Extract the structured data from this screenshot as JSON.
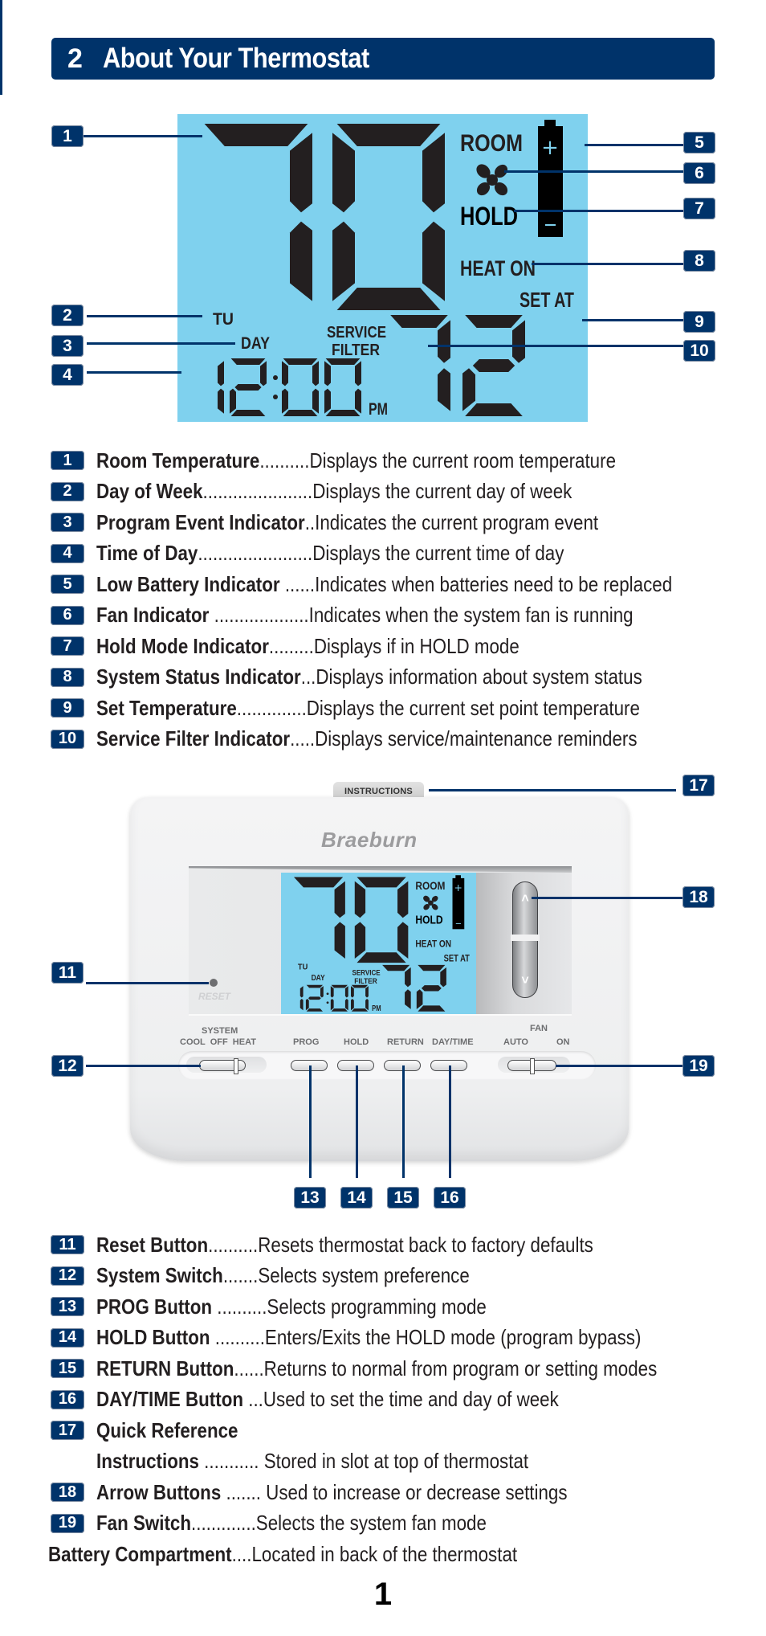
{
  "header": {
    "section_number": "2",
    "title": "About Your Thermostat"
  },
  "display": {
    "room_temp": "70",
    "room_label": "ROOM",
    "hold_label": "HOLD",
    "status_label": "HEAT ON",
    "set_at_label": "SET AT",
    "set_temp": "72",
    "day": "TU",
    "event_label": "DAY",
    "time": "12:00",
    "ampm": "PM",
    "service_label_1": "SERVICE",
    "service_label_2": "FILTER",
    "battery_plus": "+",
    "battery_minus": "–",
    "fan_icon": "fan-icon",
    "battery_icon": "battery-icon"
  },
  "display_callouts": [
    "1",
    "2",
    "3",
    "4",
    "5",
    "6",
    "7",
    "8",
    "9",
    "10"
  ],
  "display_legend": [
    {
      "num": "1",
      "label": "Room Temperature",
      "dots": "..........",
      "desc": "Displays the current room temperature"
    },
    {
      "num": "2",
      "label": "Day of Week",
      "dots": "......................",
      "desc": "Displays the current day of week"
    },
    {
      "num": "3",
      "label": "Program Event Indicator",
      "dots": "..",
      "desc": "Indicates the current program event"
    },
    {
      "num": "4",
      "label": "Time of Day",
      "dots": ".......................",
      "desc": "Displays the current time of day"
    },
    {
      "num": "5",
      "label": "Low Battery Indicator",
      "dots": " ......",
      "desc": "Indicates when batteries need to be replaced"
    },
    {
      "num": "6",
      "label": "Fan Indicator",
      "dots": " ...................",
      "desc": "Indicates when the system fan is running"
    },
    {
      "num": "7",
      "label": "Hold Mode Indicator",
      "dots": ".........",
      "desc": "Displays if in HOLD mode"
    },
    {
      "num": "8",
      "label": "System Status Indicator",
      "dots": "...",
      "desc": "Displays information about system status"
    },
    {
      "num": "9",
      "label": "Set Temperature",
      "dots": "..............",
      "desc": "Displays the current set point temperature"
    },
    {
      "num": "10",
      "label": "Service Filter Indicator",
      "dots": ".....",
      "desc": "Displays service/maintenance reminders"
    }
  ],
  "device": {
    "instructions_tab": "INSTRUCTIONS",
    "brand": "Braeburn",
    "reset_label": "RESET",
    "system_label": "SYSTEM",
    "system_options": "COOL  OFF  HEAT",
    "prog_label": "PROG",
    "hold_label": "HOLD",
    "return_label": "RETURN",
    "daytime_label": "DAY/TIME",
    "fan_label": "FAN",
    "fan_auto": "AUTO",
    "fan_on": "ON",
    "arrow_up": "˄",
    "arrow_down": "˅"
  },
  "device_callouts": [
    "11",
    "12",
    "13",
    "14",
    "15",
    "16",
    "17",
    "18",
    "19"
  ],
  "device_legend": [
    {
      "num": "11",
      "label": "Reset Button",
      "dots": "..........",
      "desc": "Resets thermostat back to factory defaults"
    },
    {
      "num": "12",
      "label": "System Switch",
      "dots": ".......",
      "desc": "Selects system preference"
    },
    {
      "num": "13",
      "label": "PROG Button",
      "dots": " ..........",
      "desc": "Selects programming mode"
    },
    {
      "num": "14",
      "label": "HOLD Button",
      "dots": " ..........",
      "desc": "Enters/Exits the HOLD mode (program bypass)"
    },
    {
      "num": "15",
      "label": "RETURN Button",
      "dots": "......",
      "desc": "Returns to normal from program or setting modes"
    },
    {
      "num": "16",
      "label": "DAY/TIME Button",
      "dots": " ...",
      "desc": "Used to set the time and day of week"
    },
    {
      "num": "17",
      "label": "Quick Reference",
      "label2": "Instructions",
      "dots": " ........... ",
      "desc": "Stored in slot at top of thermostat"
    },
    {
      "num": "18",
      "label": "Arrow Buttons",
      "dots": " ....... ",
      "desc": "Used to increase or decrease settings"
    },
    {
      "num": "19",
      "label": "Fan Switch",
      "dots": ".............",
      "desc": "Selects the system fan mode"
    }
  ],
  "battery_note": {
    "label": "Battery Compartment",
    "dots": "....",
    "desc": "Located in back of the thermostat"
  },
  "page_number": "1"
}
